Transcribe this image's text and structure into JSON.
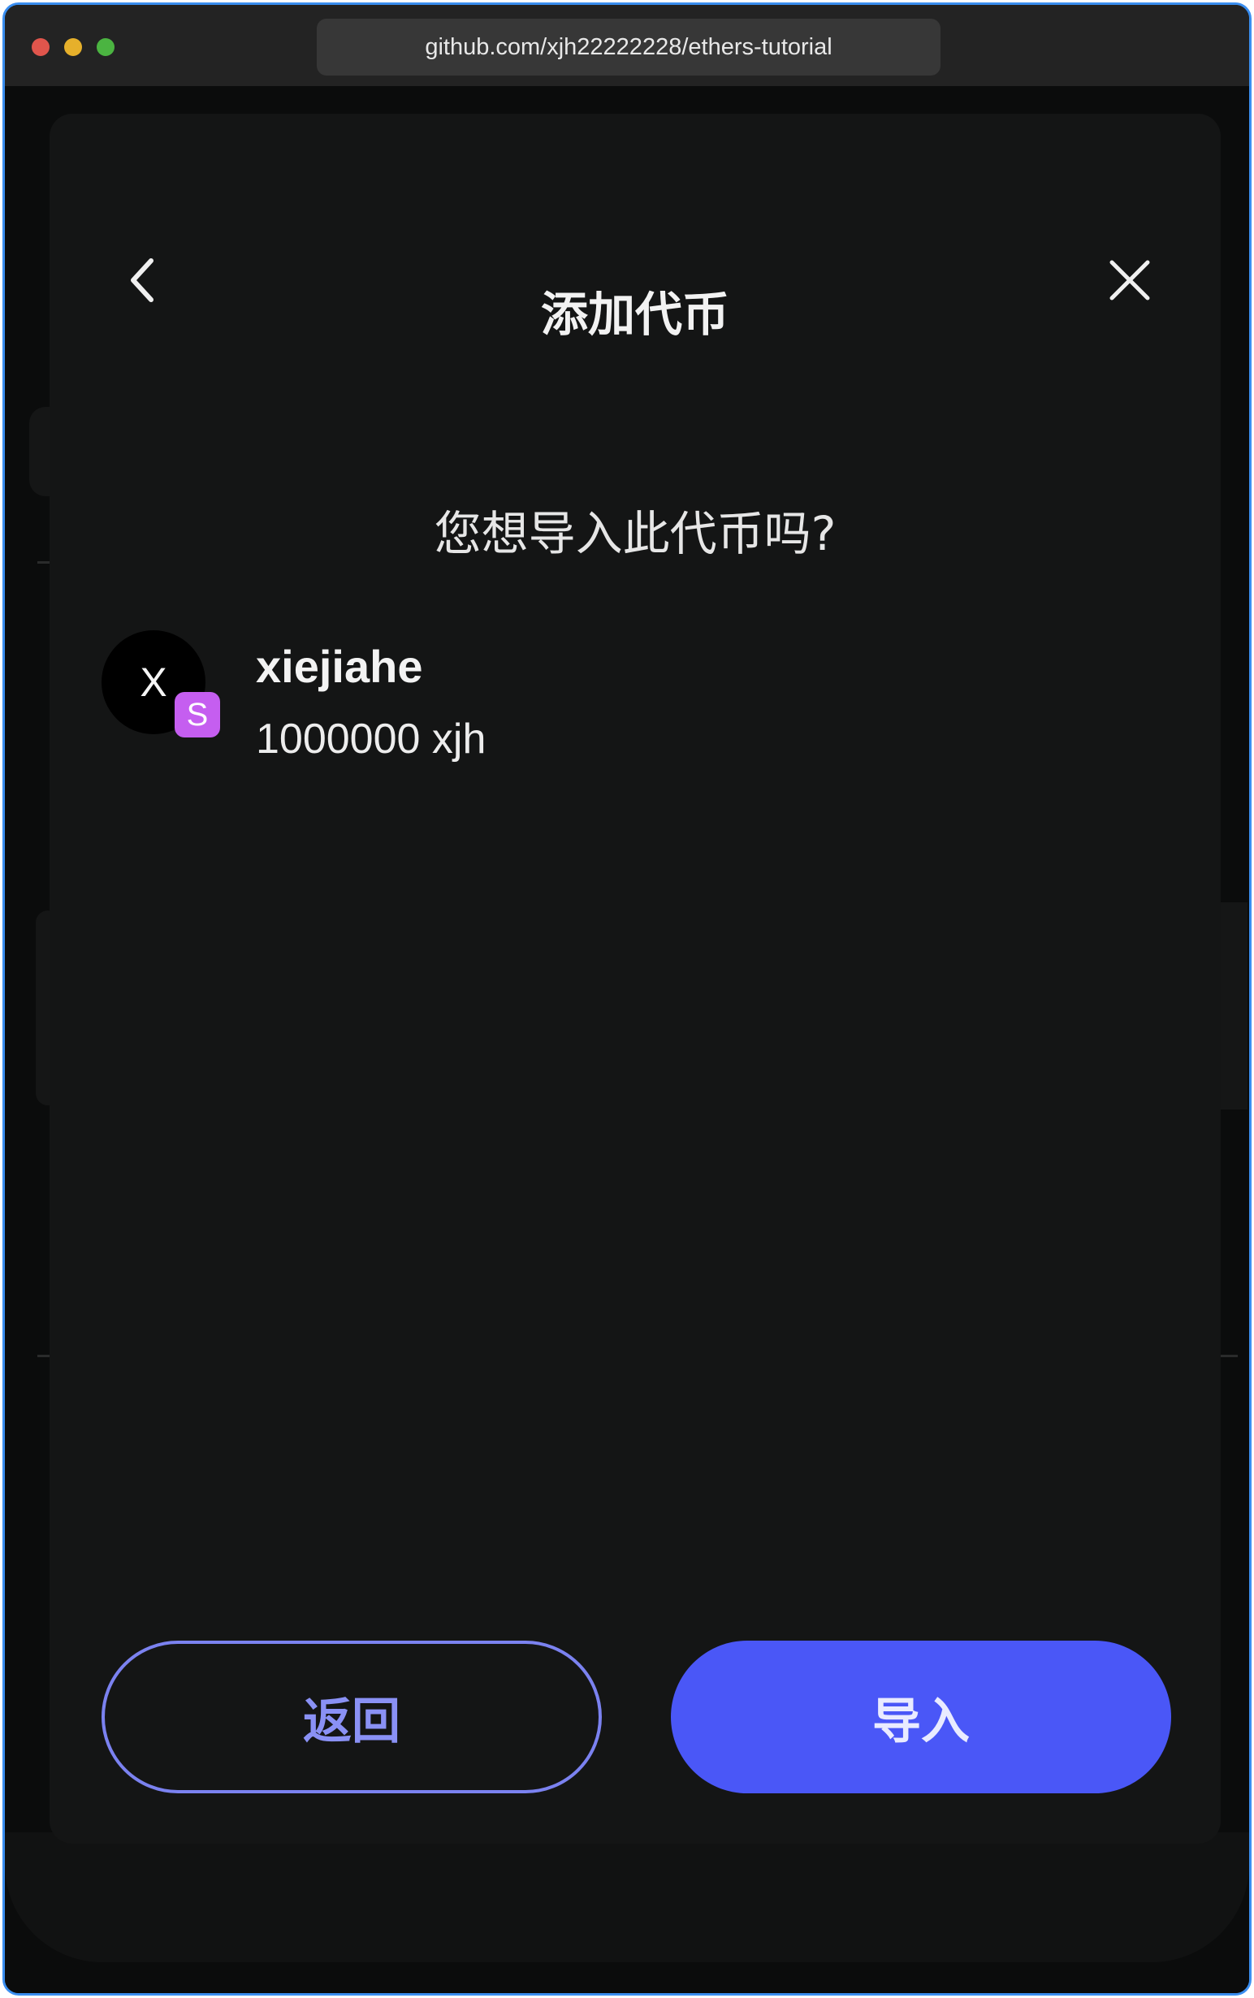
{
  "browser": {
    "url": "github.com/xjh22222228/ethers-tutorial"
  },
  "modal": {
    "title": "添加代币",
    "question": "您想导入此代币吗?",
    "token": {
      "avatar_letter": "X",
      "network_badge": "S",
      "name": "xiejiahe",
      "amount": "1000000 xjh"
    },
    "buttons": {
      "back_label": "返回",
      "import_label": "导入"
    },
    "icons": {
      "back": "chevron-left-icon",
      "close": "close-icon"
    },
    "colors": {
      "modal_bg": "#141515",
      "primary": "#4a57f7",
      "secondary_border": "#7b82f0",
      "badge": "#c55ef0"
    }
  }
}
